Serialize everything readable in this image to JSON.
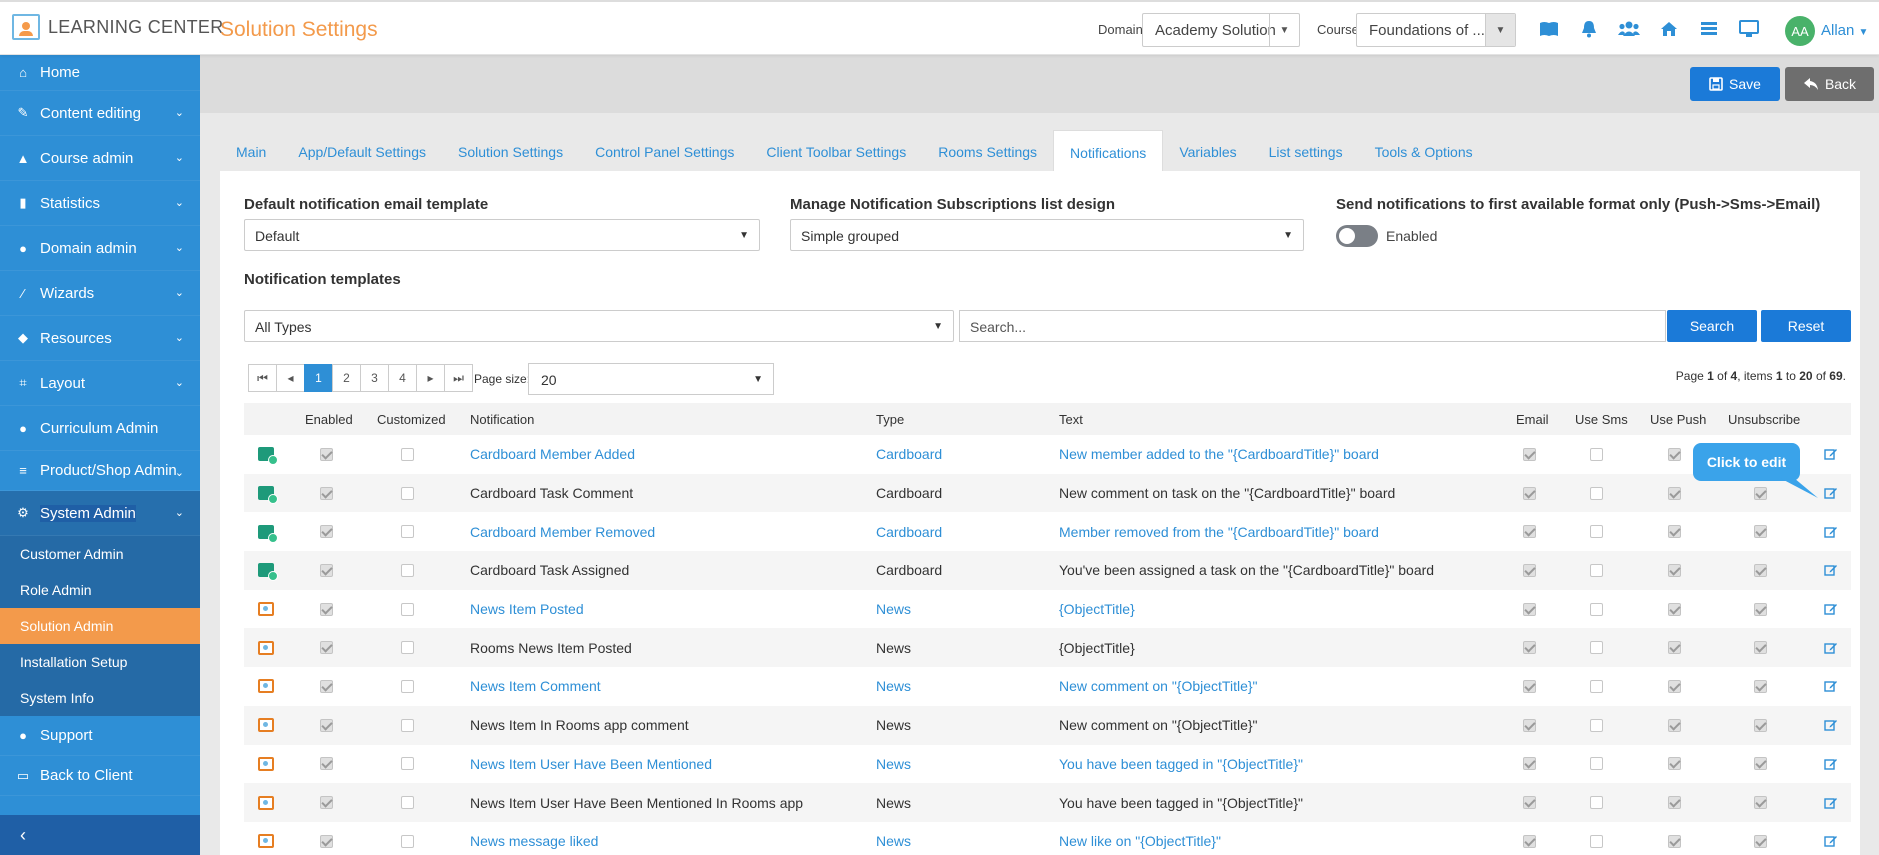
{
  "app": {
    "logo_text": "LEARNING CENTER",
    "page_title": "Solution Settings"
  },
  "top": {
    "domain_label": "Domain",
    "domain_value": "Academy Solution",
    "course_label": "Course",
    "course_value": "Foundations of ...",
    "icons": [
      "book-icon",
      "bell-icon",
      "users-icon",
      "home-icon",
      "list-icon",
      "monitor-icon"
    ],
    "user_initials": "AA",
    "user_name": "Allan"
  },
  "sidebar": {
    "items": [
      {
        "label": "Home",
        "icon": "home-icon"
      },
      {
        "label": "Content editing",
        "icon": "edit-icon"
      },
      {
        "label": "Course admin",
        "icon": "graduation-cap-icon"
      },
      {
        "label": "Statistics",
        "icon": "chart-icon"
      },
      {
        "label": "Domain admin",
        "icon": "globe-icon"
      },
      {
        "label": "Wizards",
        "icon": "magic-wand-icon"
      },
      {
        "label": "Resources",
        "icon": "cube-icon"
      },
      {
        "label": "Layout",
        "icon": "crop-icon"
      },
      {
        "label": "Curriculum Admin",
        "icon": "globe-icon"
      },
      {
        "label": "Product/Shop Admin",
        "icon": "database-icon"
      },
      {
        "label": "System Admin",
        "icon": "cogs-icon"
      }
    ],
    "subitems": [
      "Customer Admin",
      "Role Admin",
      "Solution Admin",
      "Installation Setup",
      "System Info"
    ],
    "bottom_items": [
      {
        "label": "Support",
        "icon": "globe-icon"
      },
      {
        "label": "Back to Client",
        "icon": "monitor-icon"
      }
    ]
  },
  "buttons": {
    "save": "Save",
    "back": "Back"
  },
  "tabs": [
    "Main",
    "App/Default Settings",
    "Solution Settings",
    "Control Panel Settings",
    "Client Toolbar Settings",
    "Rooms Settings",
    "Notifications",
    "Variables",
    "List settings",
    "Tools & Options"
  ],
  "form": {
    "email_template_label": "Default notification email template",
    "email_template_value": "Default",
    "subscriptions_label": "Manage Notification Subscriptions list design",
    "subscriptions_value": "Simple grouped",
    "first_format_label": "Send notifications to first available format only (Push->Sms->Email)",
    "first_format_toggle_label": "Enabled",
    "templates_label": "Notification templates",
    "type_filter_value": "All Types",
    "search_placeholder": "Search...",
    "search_button": "Search",
    "reset_button": "Reset"
  },
  "pager": {
    "pages": [
      "1",
      "2",
      "3",
      "4"
    ],
    "current": "1",
    "page_size_label": "Page size:",
    "page_size": "20",
    "info_prefix": "Page ",
    "info_page": "1",
    "info_of": " of ",
    "info_pages": "4",
    "info_items": ", items ",
    "info_from": "1",
    "info_to_word": " to ",
    "info_to": "20",
    "info_of2": " of ",
    "info_total": "69",
    "info_end": "."
  },
  "table": {
    "headers": [
      "Enabled",
      "Customized",
      "Notification",
      "Type",
      "Text",
      "Email",
      "Use Sms",
      "Use Push",
      "Unsubscribe"
    ],
    "rows": [
      {
        "icon": "card",
        "notification": "Cardboard Member Added",
        "type": "Cardboard",
        "text": "New member added to the \"{CardboardTitle}\" board",
        "link": true
      },
      {
        "icon": "card",
        "notification": "Cardboard Task Comment",
        "type": "Cardboard",
        "text": "New comment on task on the \"{CardboardTitle}\" board",
        "link": false
      },
      {
        "icon": "card",
        "notification": "Cardboard Member Removed",
        "type": "Cardboard",
        "text": "Member removed from the \"{CardboardTitle}\" board",
        "link": true
      },
      {
        "icon": "card",
        "notification": "Cardboard Task Assigned",
        "type": "Cardboard",
        "text": "You've been assigned a task on the \"{CardboardTitle}\" board",
        "link": false
      },
      {
        "icon": "news",
        "notification": "News Item Posted",
        "type": "News",
        "text": "{ObjectTitle}",
        "link": true
      },
      {
        "icon": "news",
        "notification": "Rooms News Item Posted",
        "type": "News",
        "text": "{ObjectTitle}",
        "link": false
      },
      {
        "icon": "news",
        "notification": "News Item Comment",
        "type": "News",
        "text": "New comment on \"{ObjectTitle}\"",
        "link": true
      },
      {
        "icon": "news",
        "notification": "News Item In Rooms app comment",
        "type": "News",
        "text": "New comment on \"{ObjectTitle}\"",
        "link": false
      },
      {
        "icon": "news",
        "notification": "News Item User Have Been Mentioned",
        "type": "News",
        "text": "You have been tagged in \"{ObjectTitle}\"",
        "link": true
      },
      {
        "icon": "news",
        "notification": "News Item User Have Been Mentioned In Rooms app",
        "type": "News",
        "text": "You have been tagged in \"{ObjectTitle}\"",
        "link": false
      },
      {
        "icon": "news",
        "notification": "News message liked",
        "type": "News",
        "text": "New like on \"{ObjectTitle}\"",
        "link": true
      }
    ]
  },
  "tooltip": "Click to edit"
}
